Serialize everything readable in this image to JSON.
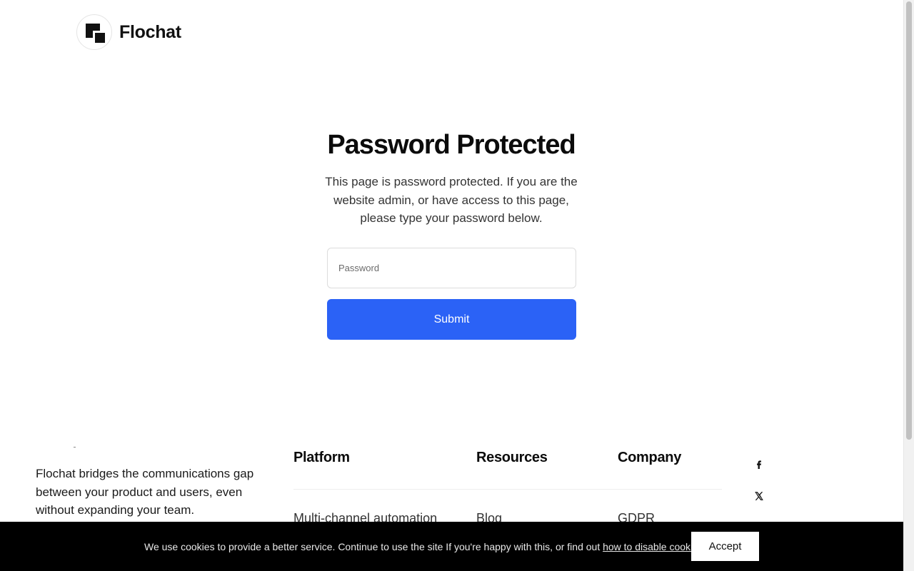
{
  "brand": {
    "name": "Flochat"
  },
  "protect": {
    "title": "Password Protected",
    "description": "This page is password protected. If you are the website admin, or have access to this page, please type your password below.",
    "password_placeholder": "Password",
    "submit_label": "Submit"
  },
  "footer": {
    "description": "Flochat bridges the communications gap between your product and users, even without expanding your team.",
    "columns": [
      {
        "heading": "Platform",
        "links": [
          "Multi-channel automation"
        ]
      },
      {
        "heading": "Resources",
        "links": [
          "Blog"
        ]
      },
      {
        "heading": "Company",
        "links": [
          "GDPR"
        ]
      }
    ],
    "social": [
      "facebook-icon",
      "x-icon"
    ]
  },
  "cookie": {
    "text_before": "We use cookies to provide a better service. Continue to use the site If you're happy with this, or find out ",
    "link_text": "how to disable cookies",
    "text_after": ".",
    "accept_label": "Accept"
  },
  "colors": {
    "accent": "#2b62f6",
    "cookie_bar": "#000000"
  }
}
